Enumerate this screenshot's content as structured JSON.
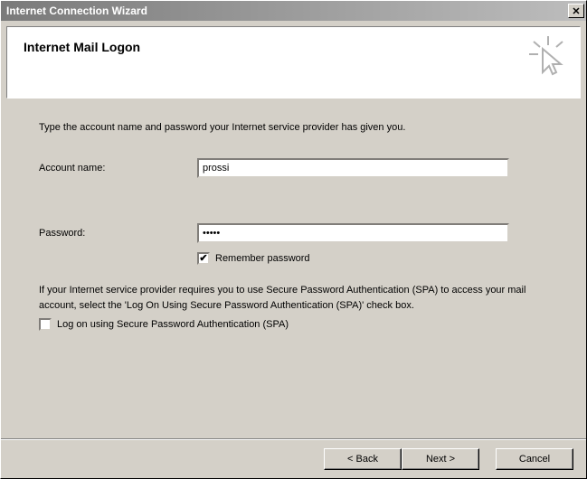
{
  "window": {
    "title": "Internet Connection Wizard"
  },
  "header": {
    "title": "Internet Mail Logon"
  },
  "content": {
    "instruction": "Type the account name and password your Internet service provider has given you.",
    "account_label": "Account name:",
    "account_value": "prossi",
    "password_label": "Password:",
    "password_value": "•••••",
    "remember_label": "Remember password",
    "remember_checked": true,
    "spa_text": "If your Internet service provider requires you to use Secure Password Authentication (SPA) to access your mail account, select the 'Log On Using Secure Password Authentication (SPA)' check box.",
    "spa_checkbox_label": "Log on using Secure Password Authentication (SPA)",
    "spa_checked": false
  },
  "buttons": {
    "back": "< Back",
    "next": "Next >",
    "cancel": "Cancel"
  }
}
